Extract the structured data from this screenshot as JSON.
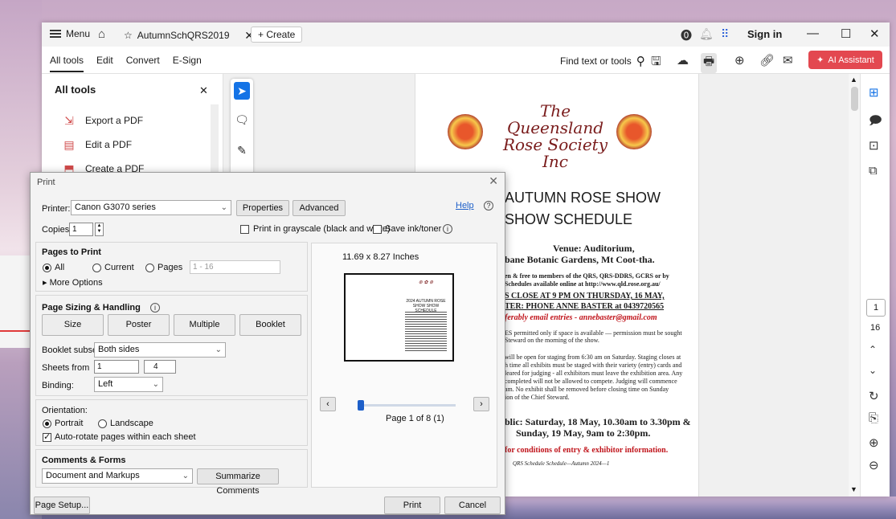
{
  "titlebar": {
    "menu_label": "Menu",
    "tab_title": "AutumnSchQRS2019",
    "create_label": "+ Create",
    "sign_in": "Sign in"
  },
  "toolbar": {
    "nav": [
      "All tools",
      "Edit",
      "Convert",
      "E-Sign"
    ],
    "find_label": "Find text or tools",
    "ai_assistant": "AI Assistant"
  },
  "tools_panel": {
    "title": "All tools",
    "items": [
      "Export a PDF",
      "Edit a PDF",
      "Create a PDF"
    ]
  },
  "document": {
    "script_title": "The Queensland Rose Society Inc",
    "heading1": "AUTUMN ROSE SHOW",
    "heading2": "SHOW SCHEDULE",
    "venue_line1": "Venue: Auditorium,",
    "venue_line2": "bane Botanic Gardens, Mt Coot-tha.",
    "line_free1": "en & free to members of the QRS, QRS-DDRS, GCRS or by",
    "line_free2": "Schedules available online at http://www.qld.rose.org.au/",
    "close_line1": "S CLOSE AT 9 PM ON THURSDAY, 16 MAY,",
    "close_line2": "TER: PHONE ANNE BASTER at 0439720565",
    "email_line": "ferably email entries - annebaster@gmail.com",
    "late_line1": "ES permitted only if space is available — permission must be sought",
    "late_line2": "Steward on the morning of the show.",
    "stage_line1": "will be open for staging from 6:30 am on Saturday. Staging closes at",
    "stage_line2": "h time all exhibits must be staged with their variety (entry) cards and",
    "stage_line3": "leared for judging - all exhibitors must leave the exhibition area. Any",
    "stage_line4": "completed will not be allowed to compete. Judging will commence",
    "stage_line5": "am. No exhibit shall be removed before closing time on Sunday",
    "stage_line6": "ion of the Chief Steward.",
    "public_line1": "blic: Saturday, 18 May, 10.30am to 3.30pm &",
    "public_line2": "Sunday, 19 May, 9am to 2:30pm.",
    "conditions_line": "for conditions of entry & exhibitor information.",
    "footer_line": "QRS Schedule Schedule—Autumn 2024—1"
  },
  "right_rail": {
    "current_page": "1",
    "total_pages": "16"
  },
  "print_dialog": {
    "title": "Print",
    "printer_label": "Printer:",
    "printer_value": "Canon G3070 series",
    "properties": "Properties",
    "advanced": "Advanced",
    "help": "Help",
    "copies_label": "Copies:",
    "copies_value": "1",
    "grayscale": "Print in grayscale (black and white)",
    "save_ink": "Save ink/toner",
    "pages_to_print": "Pages to Print",
    "all": "All",
    "current": "Current",
    "pages": "Pages",
    "pages_range": "1 - 16",
    "more_options": "More Options",
    "sizing_title": "Page Sizing & Handling",
    "sizing_buttons": [
      "Size",
      "Poster",
      "Multiple",
      "Booklet"
    ],
    "booklet_subset_label": "Booklet subset:",
    "booklet_subset_value": "Both sides",
    "sheets_from_label": "Sheets from",
    "sheets_from": "1",
    "sheets_to_label": "to",
    "sheets_to": "4",
    "binding_label": "Binding:",
    "binding_value": "Left",
    "orientation_label": "Orientation:",
    "portrait": "Portrait",
    "landscape": "Landscape",
    "auto_rotate": "Auto-rotate pages within each sheet",
    "comments_title": "Comments & Forms",
    "comments_value": "Document and Markups",
    "summarize": "Summarize Comments",
    "preview_size": "11.69 x 8.27 Inches",
    "preview_mini_title": "2024 AUTUMN ROSE SHOW SHOW SCHEDULE",
    "page_of": "Page 1 of 8 (1)",
    "page_setup": "Page Setup...",
    "print_btn": "Print",
    "cancel_btn": "Cancel"
  }
}
